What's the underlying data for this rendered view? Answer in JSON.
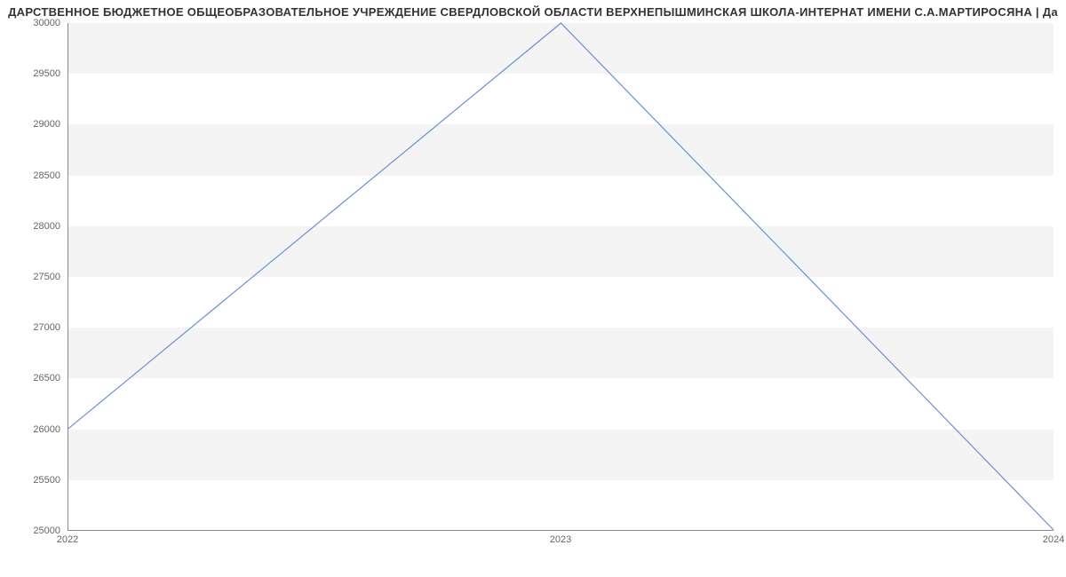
{
  "chart_data": {
    "type": "line",
    "title": "ДАРСТВЕННОЕ БЮДЖЕТНОЕ ОБЩЕОБРАЗОВАТЕЛЬНОЕ УЧРЕЖДЕНИЕ СВЕРДЛОВСКОЙ ОБЛАСТИ ВЕРХНЕПЫШМИНСКАЯ ШКОЛА-ИНТЕРНАТ ИМЕНИ С.А.МАРТИРОСЯНА | Да",
    "x": [
      2022,
      2023,
      2024
    ],
    "values": [
      26000,
      30000,
      25000
    ],
    "xlabel": "",
    "ylabel": "",
    "xlim": [
      2022,
      2024
    ],
    "ylim": [
      25000,
      30000
    ],
    "y_ticks": [
      25000,
      25500,
      26000,
      26500,
      27000,
      27500,
      28000,
      28500,
      29000,
      29500,
      30000
    ],
    "x_ticks": [
      2022,
      2023,
      2024
    ]
  }
}
